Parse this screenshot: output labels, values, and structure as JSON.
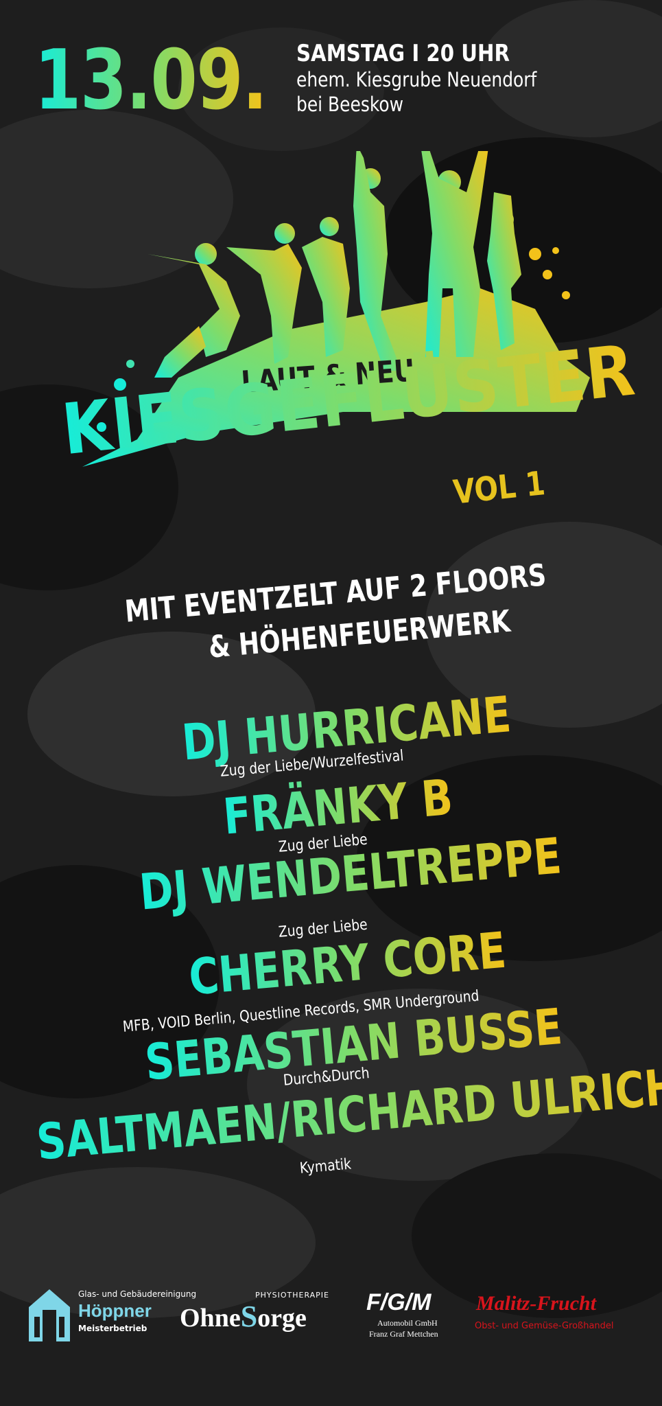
{
  "event": {
    "date": "13.09.",
    "day_time": "SAMSTAG I 20 UHR",
    "venue_line1": "ehem. Kiesgrube Neuendorf",
    "venue_line2": "bei Beeskow"
  },
  "branding": {
    "kicker": "LAUT & NEU",
    "title": "KIESGEFLÜSTER",
    "edition": "VOL 1"
  },
  "tagline": {
    "line1": "MIT EVENTZELT AUF 2 FLOORS",
    "line2": "& HÖHENFEUERWERK"
  },
  "lineup": [
    {
      "name": "DJ HURRICANE",
      "info": "Zug der Liebe/Wurzelfestival"
    },
    {
      "name": "FRÄNKY B",
      "info": "Zug der Liebe"
    },
    {
      "name": "DJ WENDELTREPPE",
      "info": "Zug der Liebe"
    },
    {
      "name": "CHERRY CORE",
      "info": "MFB, VOID Berlin, Questline Records, SMR Underground"
    },
    {
      "name": "SEBASTIAN BUSSE",
      "info": "Durch&Durch"
    },
    {
      "name": "SALTMAEN/RICHARD ULRICH",
      "info": "Kymatik"
    }
  ],
  "sponsors": {
    "hoeppner": {
      "line1": "Glas- und Gebäudereinigung",
      "name": "Höppner",
      "line3": "Meisterbetrieb"
    },
    "ohnesorge": {
      "pre": "Ohne",
      "post": "orge",
      "tag": "PHYSIOTHERAPIE"
    },
    "fgm": {
      "mark": "F/G/M",
      "line1": "Automobil GmbH",
      "line2": "Franz Graf Mettchen"
    },
    "malitz": {
      "name": "Malitz-Frucht",
      "tag": "Obst- und Gemüse-Großhandel"
    }
  },
  "colors": {
    "accent_cyan": "#16ecd9",
    "accent_green": "#7fdc6a",
    "accent_yellow": "#f3c21a",
    "background": "#1e1e1e",
    "malitz_red": "#d8141c"
  }
}
